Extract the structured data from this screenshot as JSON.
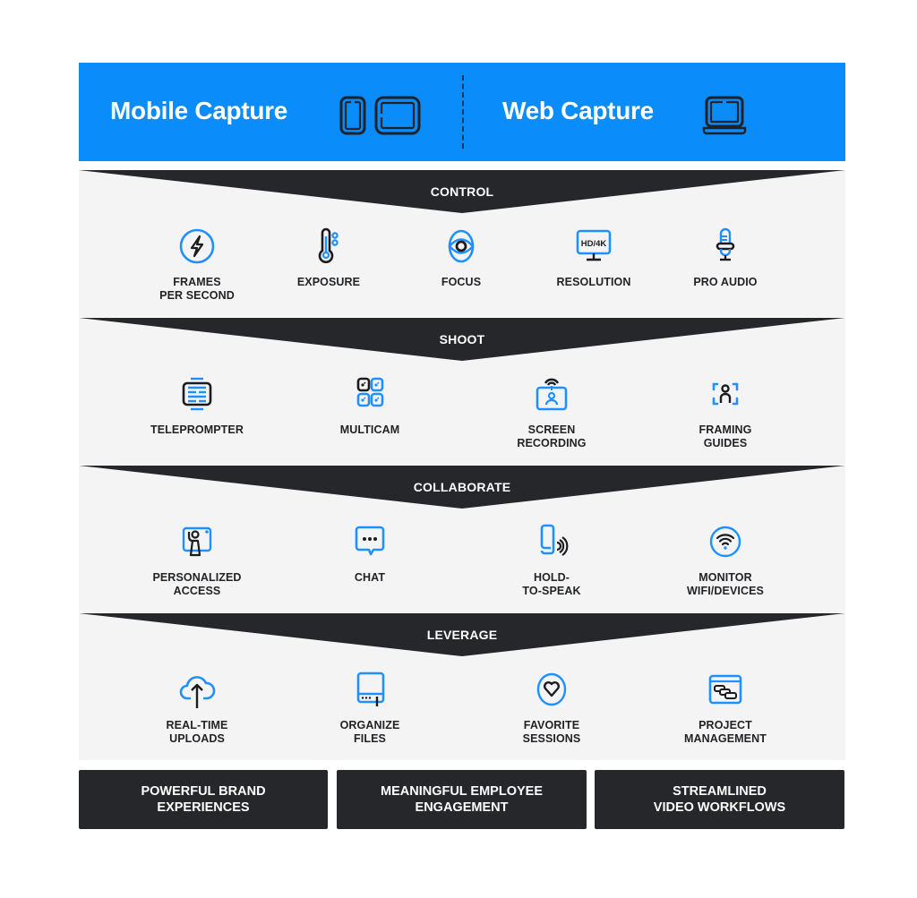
{
  "colors": {
    "brand_blue": "#0a8cfb",
    "dark": "#26272b",
    "panel_bg": "#f4f4f4",
    "icon_blue": "#1e90ff",
    "icon_dark": "#1b1c1f"
  },
  "header": {
    "mobile_title": "Mobile Capture",
    "web_title": "Web Capture",
    "mobile_icons": [
      "phone-icon",
      "tablet-icon"
    ],
    "web_icons": [
      "laptop-icon"
    ]
  },
  "stages": [
    {
      "label": "CONTROL",
      "items": [
        {
          "label": "FRAMES\nPER SECOND",
          "icon": "lightning-circle-icon"
        },
        {
          "label": "EXPOSURE",
          "icon": "thermometer-icon"
        },
        {
          "label": "FOCUS",
          "icon": "focus-eye-icon"
        },
        {
          "label": "RESOLUTION",
          "icon": "hd-4k-monitor-icon"
        },
        {
          "label": "PRO AUDIO",
          "icon": "microphone-icon"
        }
      ]
    },
    {
      "label": "SHOOT",
      "items": [
        {
          "label": "TELEPROMPTER",
          "icon": "teleprompter-icon"
        },
        {
          "label": "MULTICAM",
          "icon": "multicam-grid-icon"
        },
        {
          "label": "SCREEN\nRECORDING",
          "icon": "screen-recording-icon"
        },
        {
          "label": "FRAMING\nGUIDES",
          "icon": "framing-guides-icon"
        }
      ]
    },
    {
      "label": "COLLABORATE",
      "items": [
        {
          "label": "PERSONALIZED\nACCESS",
          "icon": "personalized-access-icon"
        },
        {
          "label": "CHAT",
          "icon": "chat-bubble-icon"
        },
        {
          "label": "HOLD-\nTO-SPEAK",
          "icon": "hold-to-speak-icon"
        },
        {
          "label": "MONITOR\nWIFI/DEVICES",
          "icon": "wifi-circle-icon"
        }
      ]
    },
    {
      "label": "LEVERAGE",
      "items": [
        {
          "label": "REAL-TIME\nUPLOADS",
          "icon": "cloud-upload-icon"
        },
        {
          "label": "ORGANIZE\nFILES",
          "icon": "file-drive-icon"
        },
        {
          "label": "FAVORITE\nSESSIONS",
          "icon": "heart-circle-icon"
        },
        {
          "label": "PROJECT\nMANAGEMENT",
          "icon": "project-window-icon"
        }
      ]
    }
  ],
  "outcomes": [
    "POWERFUL BRAND\nEXPERIENCES",
    "MEANINGFUL EMPLOYEE\nENGAGEMENT",
    "STREAMLINED\nVIDEO WORKFLOWS"
  ]
}
